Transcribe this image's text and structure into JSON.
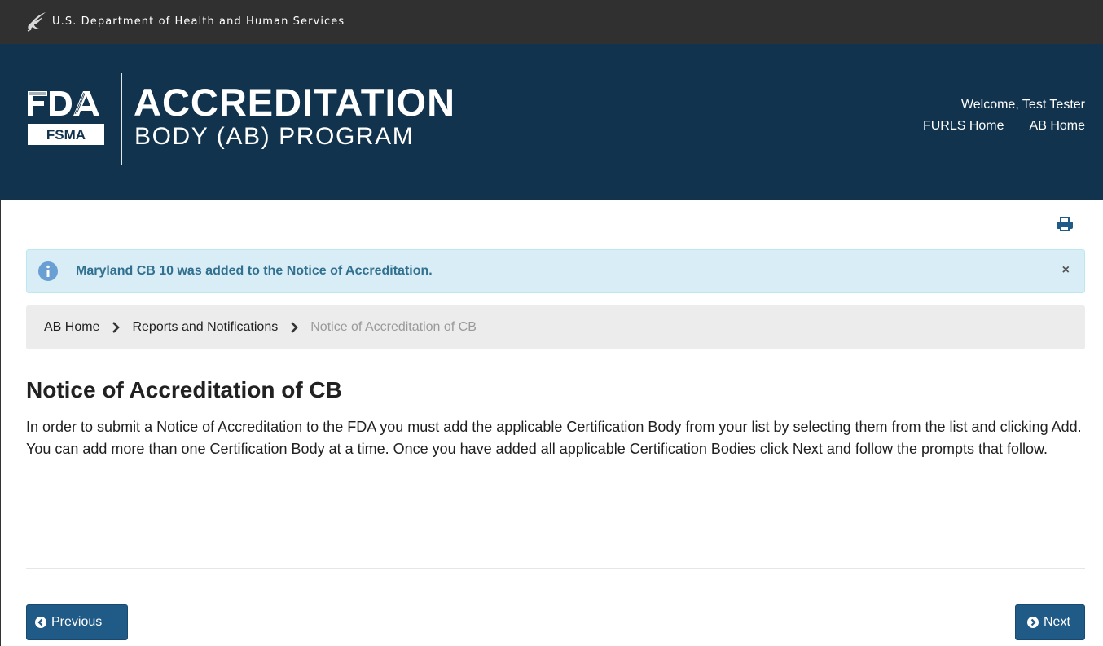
{
  "top_bar": {
    "agency": "U.S. Department of Health and Human Services",
    "icon": "hhs-eagle-icon"
  },
  "header": {
    "logo": {
      "agency": "FDA",
      "program": "FSMA"
    },
    "title_line1": "ACCREDITATION",
    "title_line2": "BODY (AB) PROGRAM",
    "welcome": "Welcome, Test Tester",
    "links": [
      "FURLS Home",
      "AB Home"
    ],
    "background": "#12334e"
  },
  "toolbar": {
    "print_icon": "print-icon"
  },
  "alert": {
    "message": "Maryland CB 10 was added to the Notice of Accreditation.",
    "close": "×",
    "icon": "info-icon"
  },
  "breadcrumb": {
    "items": [
      "AB Home",
      "Reports and Notifications"
    ],
    "current": "Notice of Accreditation of CB"
  },
  "main": {
    "title": "Notice of Accreditation of CB",
    "intro": "In order to submit a Notice of Accreditation to the FDA you must add the applicable Certification Body from your list by selecting them from the list and clicking Add. You can add more than one Certification Body at a time. Once you have added all applicable Certification Bodies click Next and follow the prompts that follow."
  },
  "nav_buttons": {
    "previous": "Previous",
    "next": "Next",
    "color": "#205a87"
  }
}
